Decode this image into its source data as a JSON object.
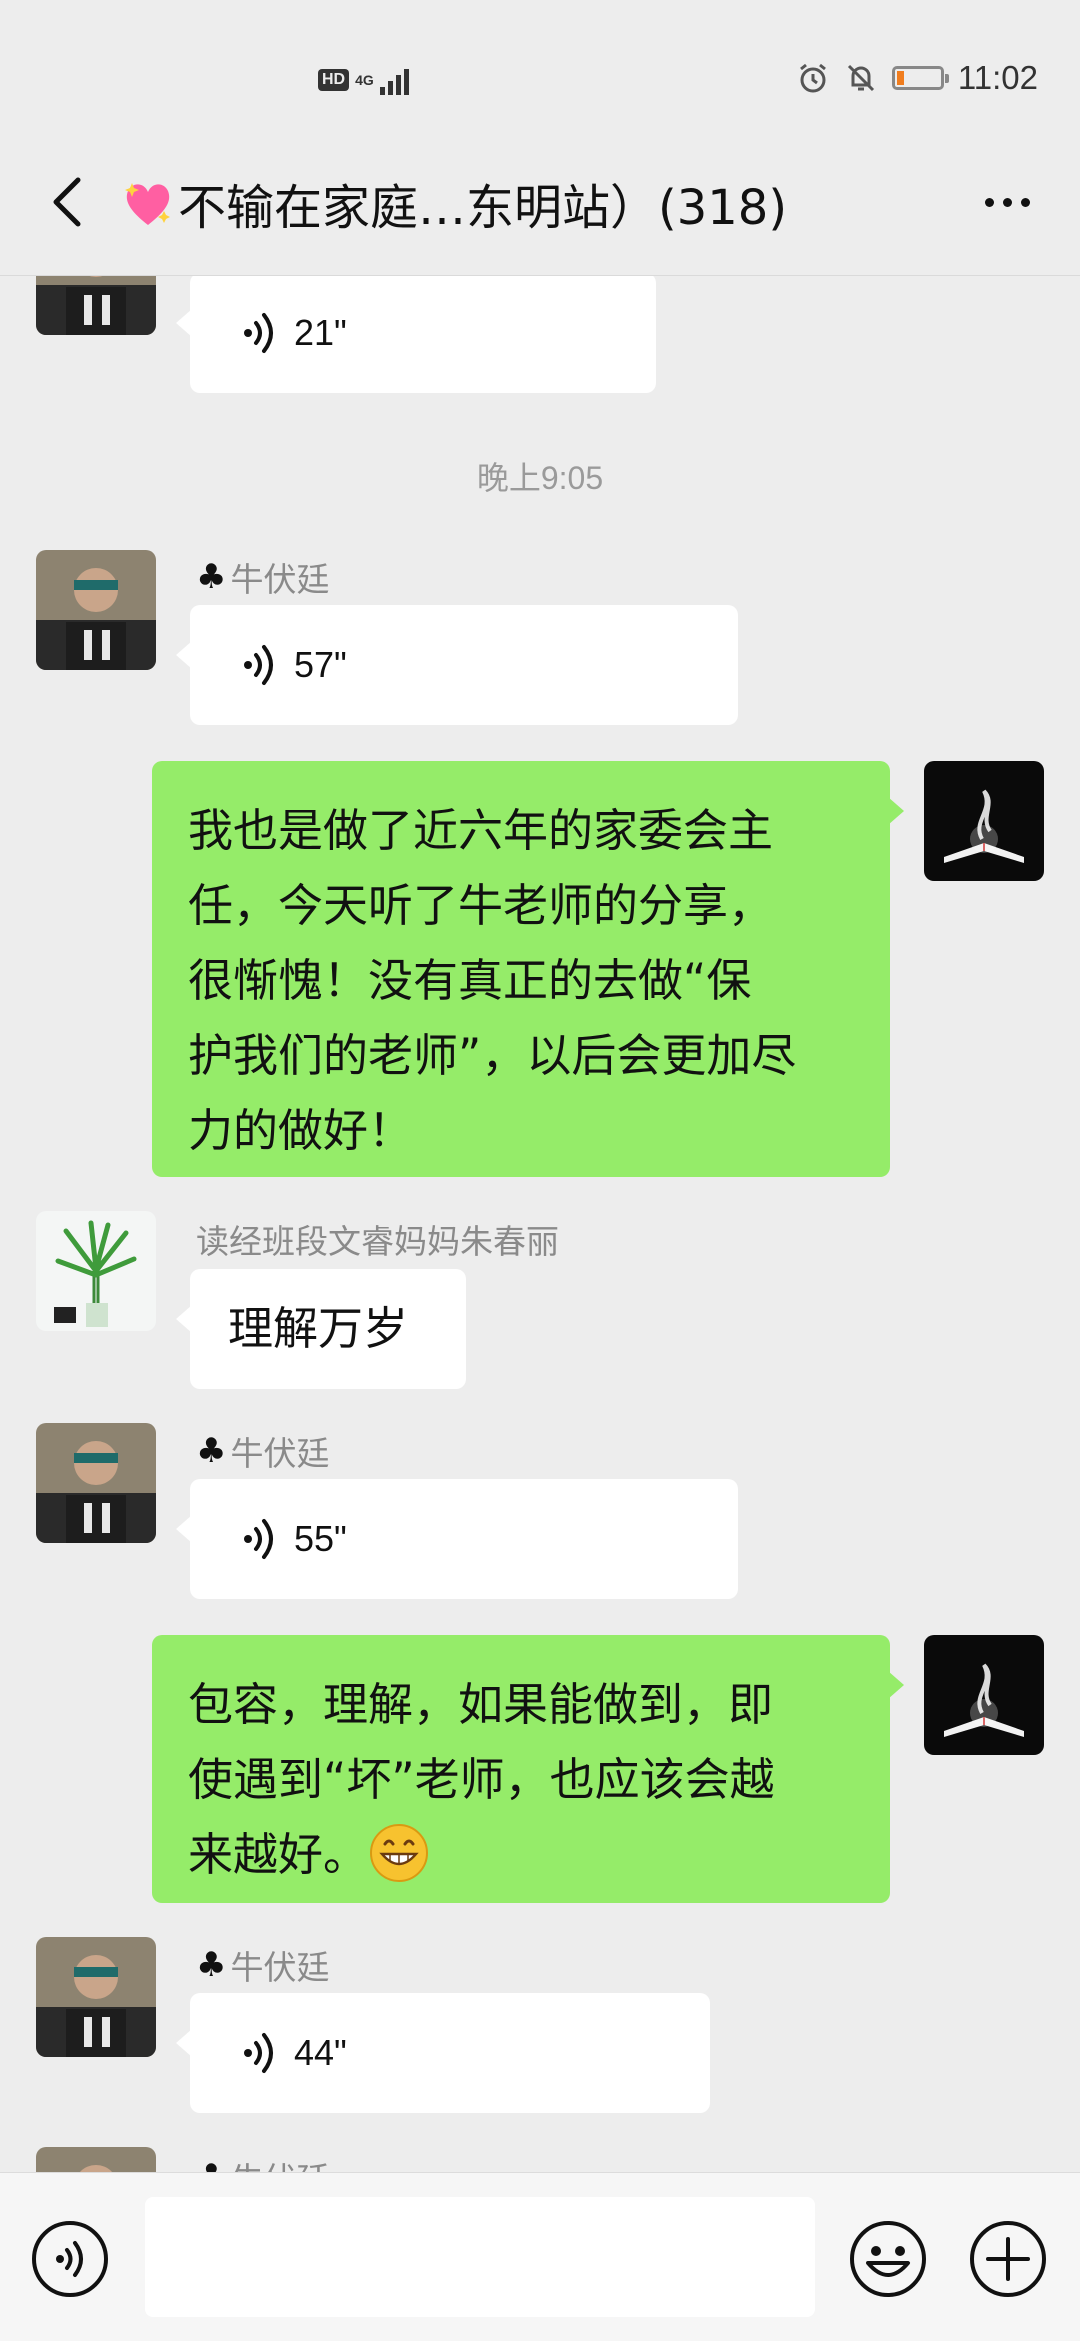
{
  "status_bar": {
    "hd": "HD",
    "network": "4G",
    "time": "11:02",
    "battery_level": 0.15,
    "battery_color": "#f07d1e"
  },
  "nav": {
    "title": "不输在家庭…东明站）(318)",
    "title_emoji": "sparkling-heart-icon"
  },
  "colors": {
    "background": "#ededed",
    "sent_bubble": "#95ec69",
    "received_bubble": "#ffffff"
  },
  "messages": [
    {
      "type": "voice",
      "side": "left",
      "duration": "21\""
    },
    {
      "type": "time",
      "text": "晚上9:05"
    },
    {
      "type": "voice",
      "side": "left",
      "sender": "牛伏廷",
      "sender_icon": "club-suit-icon",
      "duration": "57\""
    },
    {
      "type": "text",
      "side": "right",
      "text": "我也是做了近六年的家委会主\n任，今天听了牛老师的分享，\n很惭愧！没有真正的去做“保\n护我们的老师”，以后会更加尽\n力的做好！"
    },
    {
      "type": "text",
      "side": "left",
      "sender": "读经班段文睿妈妈朱春丽",
      "text": "理解万岁"
    },
    {
      "type": "voice",
      "side": "left",
      "sender": "牛伏廷",
      "sender_icon": "club-suit-icon",
      "duration": "55\""
    },
    {
      "type": "text",
      "side": "right",
      "text": "包容，理解，如果能做到，即\n使遇到“坏”老师，也应该会越\n来越好。",
      "trailing_emoji": "grin-emoji"
    },
    {
      "type": "voice",
      "side": "left",
      "sender": "牛伏廷",
      "sender_icon": "club-suit-icon",
      "duration": "44\""
    },
    {
      "type": "partial",
      "side": "left",
      "sender": "牛伏廷"
    }
  ],
  "input_bar": {
    "placeholder": "",
    "voice_icon": "voice-input-icon",
    "emoji_icon": "emoji-icon",
    "plus_icon": "plus-icon"
  }
}
